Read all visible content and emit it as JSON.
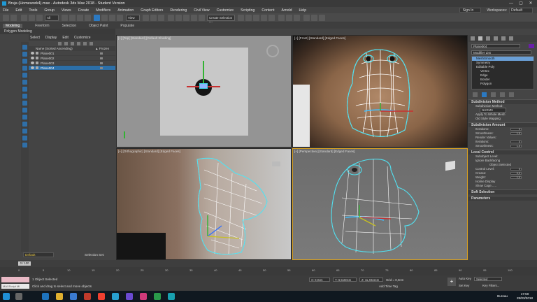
{
  "window": {
    "title": "Bruja (Homework4).max - Autodesk 3ds Max 2018 - Student Version",
    "controls": [
      "—",
      "▢",
      "✕"
    ]
  },
  "menu": {
    "items": [
      "File",
      "Edit",
      "Tools",
      "Group",
      "Views",
      "Create",
      "Modifiers",
      "Animation",
      "Graph Editors",
      "Rendering",
      "Civil View",
      "Customize",
      "Scripting",
      "Content",
      "Arnold",
      "Help"
    ],
    "signin": "Sign In",
    "workspaces_label": "Workspaces:",
    "workspaces_value": "Default"
  },
  "toolbar": {
    "filter": "All",
    "view": "View",
    "selection_set": "Create Selection Se"
  },
  "ribbon": {
    "tabs": [
      "Modeling",
      "Freeform",
      "Selection",
      "Object Paint",
      "Populate"
    ],
    "active": "Modeling",
    "subtitle": "Polygon Modeling"
  },
  "scene_explorer": {
    "tabs": [
      "Select",
      "Display",
      "Edit",
      "Customize"
    ],
    "col_name": "Name (Sorted Ascending)",
    "col_frozen": "▲ Frozen",
    "rows": [
      "Plane001",
      "Plane002",
      "Plane003",
      "Plane004"
    ],
    "selected": "Plane004",
    "layer": "Default",
    "selection_set_label": "Selection Set:"
  },
  "viewports": {
    "top": "[+] [Top] [Standard] [Default Shading]",
    "front": "[+] [Front] [Standard] [Edged Faces]",
    "ortho": "[+] [Orthographic] [Standard] [Edged Faces]",
    "persp": "[+] [Perspective] [Standard] [Edged Faces]"
  },
  "command_panel": {
    "object_name": "Plane004",
    "modifier_list": "Modifier List",
    "stack": [
      "MeshSmooth",
      "Symmetry",
      "Editable Poly",
      "Vertex",
      "Edge",
      "Border",
      "Polygon"
    ],
    "stack_selected": "MeshSmooth",
    "swatch_color": "#6a1fa8",
    "sections": {
      "subdivision_method": "Subdivision Method",
      "subdivision_method_label": "Subdivision Method:",
      "nurms": "NURMS",
      "apply_whole": "Apply To Whole Mesh",
      "old_style": "Old Style Mapping",
      "subdivision_amount": "Subdivision Amount",
      "iterations_label": "Iterations:",
      "iterations": "2",
      "smoothness_label": "Smoothness:",
      "smoothness": "1.0",
      "render_values": "Render Values:",
      "r_iterations": "Iterations:",
      "r_iterations_val": "0",
      "r_smoothness": "Smoothness:",
      "r_smoothness_val": "1.0",
      "local_control": "Local Control",
      "sublevel": "Subobject Level:",
      "ignore_backfacing": "Ignore Backfacing",
      "object_selected": "Object Selected",
      "control_level": "Control Level:",
      "control_level_val": "0",
      "crease": "Crease:",
      "crease_val": "0,0",
      "weight": "Weight:",
      "weight_val": "1,0",
      "isoline": "Isoline Display",
      "show_cage": "Show Cage......",
      "soft_selection": "Soft Selection",
      "parameters": "Parameters"
    }
  },
  "timeline": {
    "frame": "0 / 100",
    "ticks": [
      "0",
      "5",
      "10",
      "15",
      "20",
      "25",
      "30",
      "35",
      "40",
      "45",
      "50",
      "55",
      "60",
      "65",
      "70",
      "75",
      "80",
      "85",
      "90",
      "95",
      "100"
    ]
  },
  "status": {
    "maxscript": "MAXScript Mi",
    "line1": "1 Object Selected",
    "line2": "Click and drag to select and move objects",
    "x": "X: 0,0cm",
    "y": "Y: 6,5160cm",
    "z": "Z: 11,4942cm",
    "grid": "Grid = 0,0cm",
    "add_time_tag": "Add Time Tag",
    "auto_key": "Auto Key",
    "set_key": "Set Key",
    "selected": "Selected",
    "key_filters": "Key Filters..."
  },
  "taskbar": {
    "lang": "Bureau",
    "time": "17:50",
    "date": "28/03/2018"
  }
}
